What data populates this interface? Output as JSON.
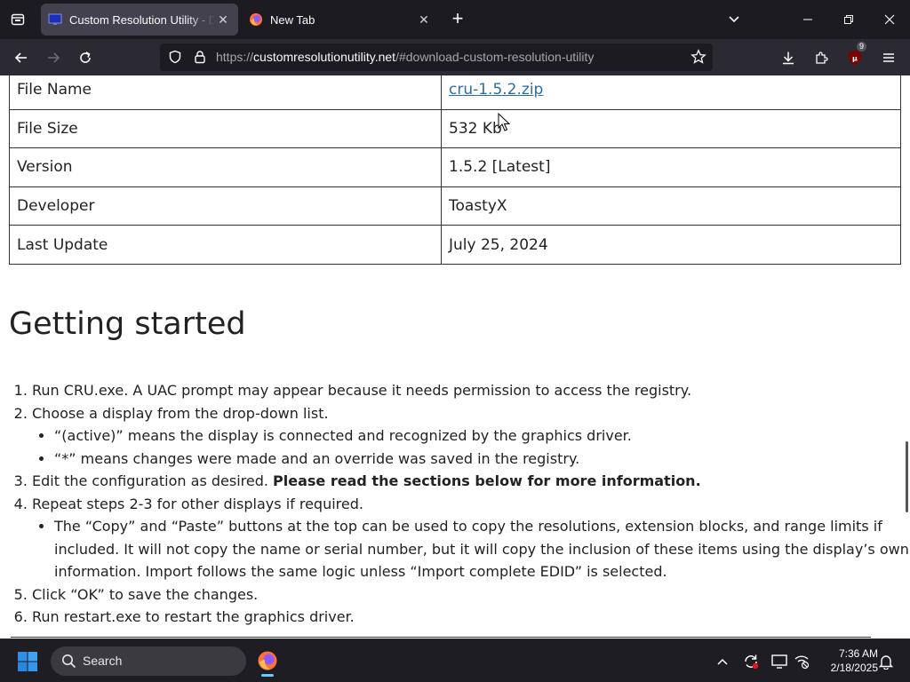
{
  "browser": {
    "tabs": [
      {
        "title": "Custom Resolution Utility - Download",
        "active": true,
        "favicon": "cru-monitor-icon"
      },
      {
        "title": "New Tab",
        "active": false,
        "favicon": "firefox-icon"
      }
    ],
    "url": {
      "scheme": "https://",
      "host": "customresolutionutility.net",
      "path": "/#download-custom-resolution-utility"
    },
    "extension_badge": "9"
  },
  "file_info": [
    {
      "label": "File Name",
      "value": "cru-1.5.2.zip",
      "is_link": true
    },
    {
      "label": "File Size",
      "value": "532 Kb"
    },
    {
      "label": "Version",
      "value": "1.5.2 [Latest]"
    },
    {
      "label": "Developer",
      "value": "ToastyX"
    },
    {
      "label": "Last Update",
      "value": "July 25, 2024"
    }
  ],
  "getting_started": {
    "title": "Getting started",
    "steps": [
      {
        "text": "Run CRU.exe. A UAC prompt may appear because it needs permission to access the registry."
      },
      {
        "text": "Choose a display from the drop-down list.",
        "sub": [
          "“(active)” means the display is connected and recognized by the graphics driver.",
          "“*” means changes were made and an override was saved in the registry."
        ]
      },
      {
        "text": "Edit the configuration as desired. ",
        "bold": "Please read the sections below for more information."
      },
      {
        "text": "Repeat steps 2-3 for other displays if required.",
        "sub": [
          "The “Copy” and “Paste” buttons at the top can be used to copy the resolutions, extension blocks, and range limits if included. It will not copy the name or serial number, but it will copy the inclusion of these items using the display’s own information. Import follows the same logic unless “Import complete EDID” is selected."
        ]
      },
      {
        "text": "Click “OK” to save the changes."
      },
      {
        "text": "Run restart.exe to restart the graphics driver."
      }
    ]
  },
  "taskbar": {
    "search_label": "Search",
    "time": "7:36 AM",
    "date": "2/18/2025"
  },
  "colors": {
    "accent_blue": "#60cdff",
    "link": "#2e6ca8",
    "firefox_orange": "#ff7139"
  }
}
